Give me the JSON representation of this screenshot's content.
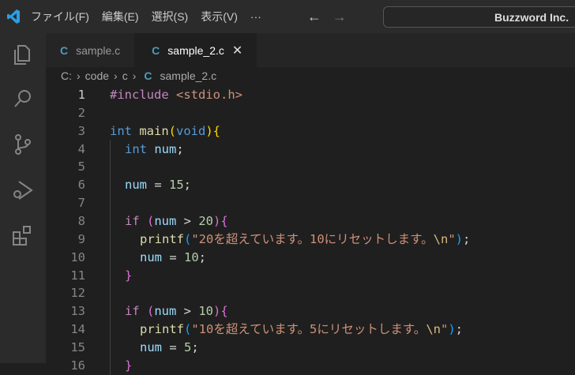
{
  "menu": [
    "ファイル(F)",
    "編集(E)",
    "選択(S)",
    "表示(V)",
    "···"
  ],
  "nav": {
    "back": "←",
    "forward": "→"
  },
  "search": {
    "text": "Buzzword Inc."
  },
  "tabs": [
    {
      "icon": "C",
      "label": "sample.c"
    },
    {
      "icon": "C",
      "label": "sample_2.c",
      "close": "✕"
    }
  ],
  "breadcrumb": {
    "drive": "C:",
    "sep": "›",
    "folder1": "code",
    "folder2": "c",
    "icon": "C",
    "file": "sample_2.c"
  },
  "code": [
    {
      "n": "1",
      "indent": 0,
      "t": [
        [
          "c",
          "#include "
        ],
        [
          "s",
          "<stdio.h>"
        ]
      ]
    },
    {
      "n": "2",
      "indent": 0,
      "t": []
    },
    {
      "n": "3",
      "indent": 0,
      "t": [
        [
          "k",
          "int "
        ],
        [
          "f",
          "main"
        ],
        [
          "b1",
          "("
        ],
        [
          "k",
          "void"
        ],
        [
          "b1",
          ")"
        ],
        [
          "b1",
          "{"
        ]
      ]
    },
    {
      "n": "4",
      "indent": 1,
      "t": [
        [
          "k",
          "int "
        ],
        [
          "v",
          "num"
        ],
        [
          "p",
          ";"
        ]
      ]
    },
    {
      "n": "5",
      "indent": 1,
      "t": []
    },
    {
      "n": "6",
      "indent": 1,
      "t": [
        [
          "v",
          "num"
        ],
        [
          "p",
          " = "
        ],
        [
          "n",
          "15"
        ],
        [
          "p",
          ";"
        ]
      ]
    },
    {
      "n": "7",
      "indent": 1,
      "t": []
    },
    {
      "n": "8",
      "indent": 1,
      "t": [
        [
          "c",
          "if "
        ],
        [
          "b2",
          "("
        ],
        [
          "v",
          "num"
        ],
        [
          "p",
          " > "
        ],
        [
          "n",
          "20"
        ],
        [
          "b2",
          ")"
        ],
        [
          "b2",
          "{"
        ]
      ]
    },
    {
      "n": "9",
      "indent": 2,
      "t": [
        [
          "f",
          "printf"
        ],
        [
          "b3",
          "("
        ],
        [
          "s",
          "\"20を超えています。10にリセットします。"
        ],
        [
          "e",
          "\\n"
        ],
        [
          "s",
          "\""
        ],
        [
          "b3",
          ")"
        ],
        [
          "p",
          ";"
        ]
      ]
    },
    {
      "n": "10",
      "indent": 2,
      "t": [
        [
          "v",
          "num"
        ],
        [
          "p",
          " = "
        ],
        [
          "n",
          "10"
        ],
        [
          "p",
          ";"
        ]
      ]
    },
    {
      "n": "11",
      "indent": 1,
      "t": [
        [
          "b2",
          "}"
        ]
      ]
    },
    {
      "n": "12",
      "indent": 1,
      "t": []
    },
    {
      "n": "13",
      "indent": 1,
      "t": [
        [
          "c",
          "if "
        ],
        [
          "b2",
          "("
        ],
        [
          "v",
          "num"
        ],
        [
          "p",
          " > "
        ],
        [
          "n",
          "10"
        ],
        [
          "b2",
          ")"
        ],
        [
          "b2",
          "{"
        ]
      ]
    },
    {
      "n": "14",
      "indent": 2,
      "t": [
        [
          "f",
          "printf"
        ],
        [
          "b3",
          "("
        ],
        [
          "s",
          "\"10を超えています。5にリセットします。"
        ],
        [
          "e",
          "\\n"
        ],
        [
          "s",
          "\""
        ],
        [
          "b3",
          ")"
        ],
        [
          "p",
          ";"
        ]
      ]
    },
    {
      "n": "15",
      "indent": 2,
      "t": [
        [
          "v",
          "num"
        ],
        [
          "p",
          " = "
        ],
        [
          "n",
          "5"
        ],
        [
          "p",
          ";"
        ]
      ]
    },
    {
      "n": "16",
      "indent": 1,
      "t": [
        [
          "b2",
          "}"
        ]
      ]
    }
  ]
}
